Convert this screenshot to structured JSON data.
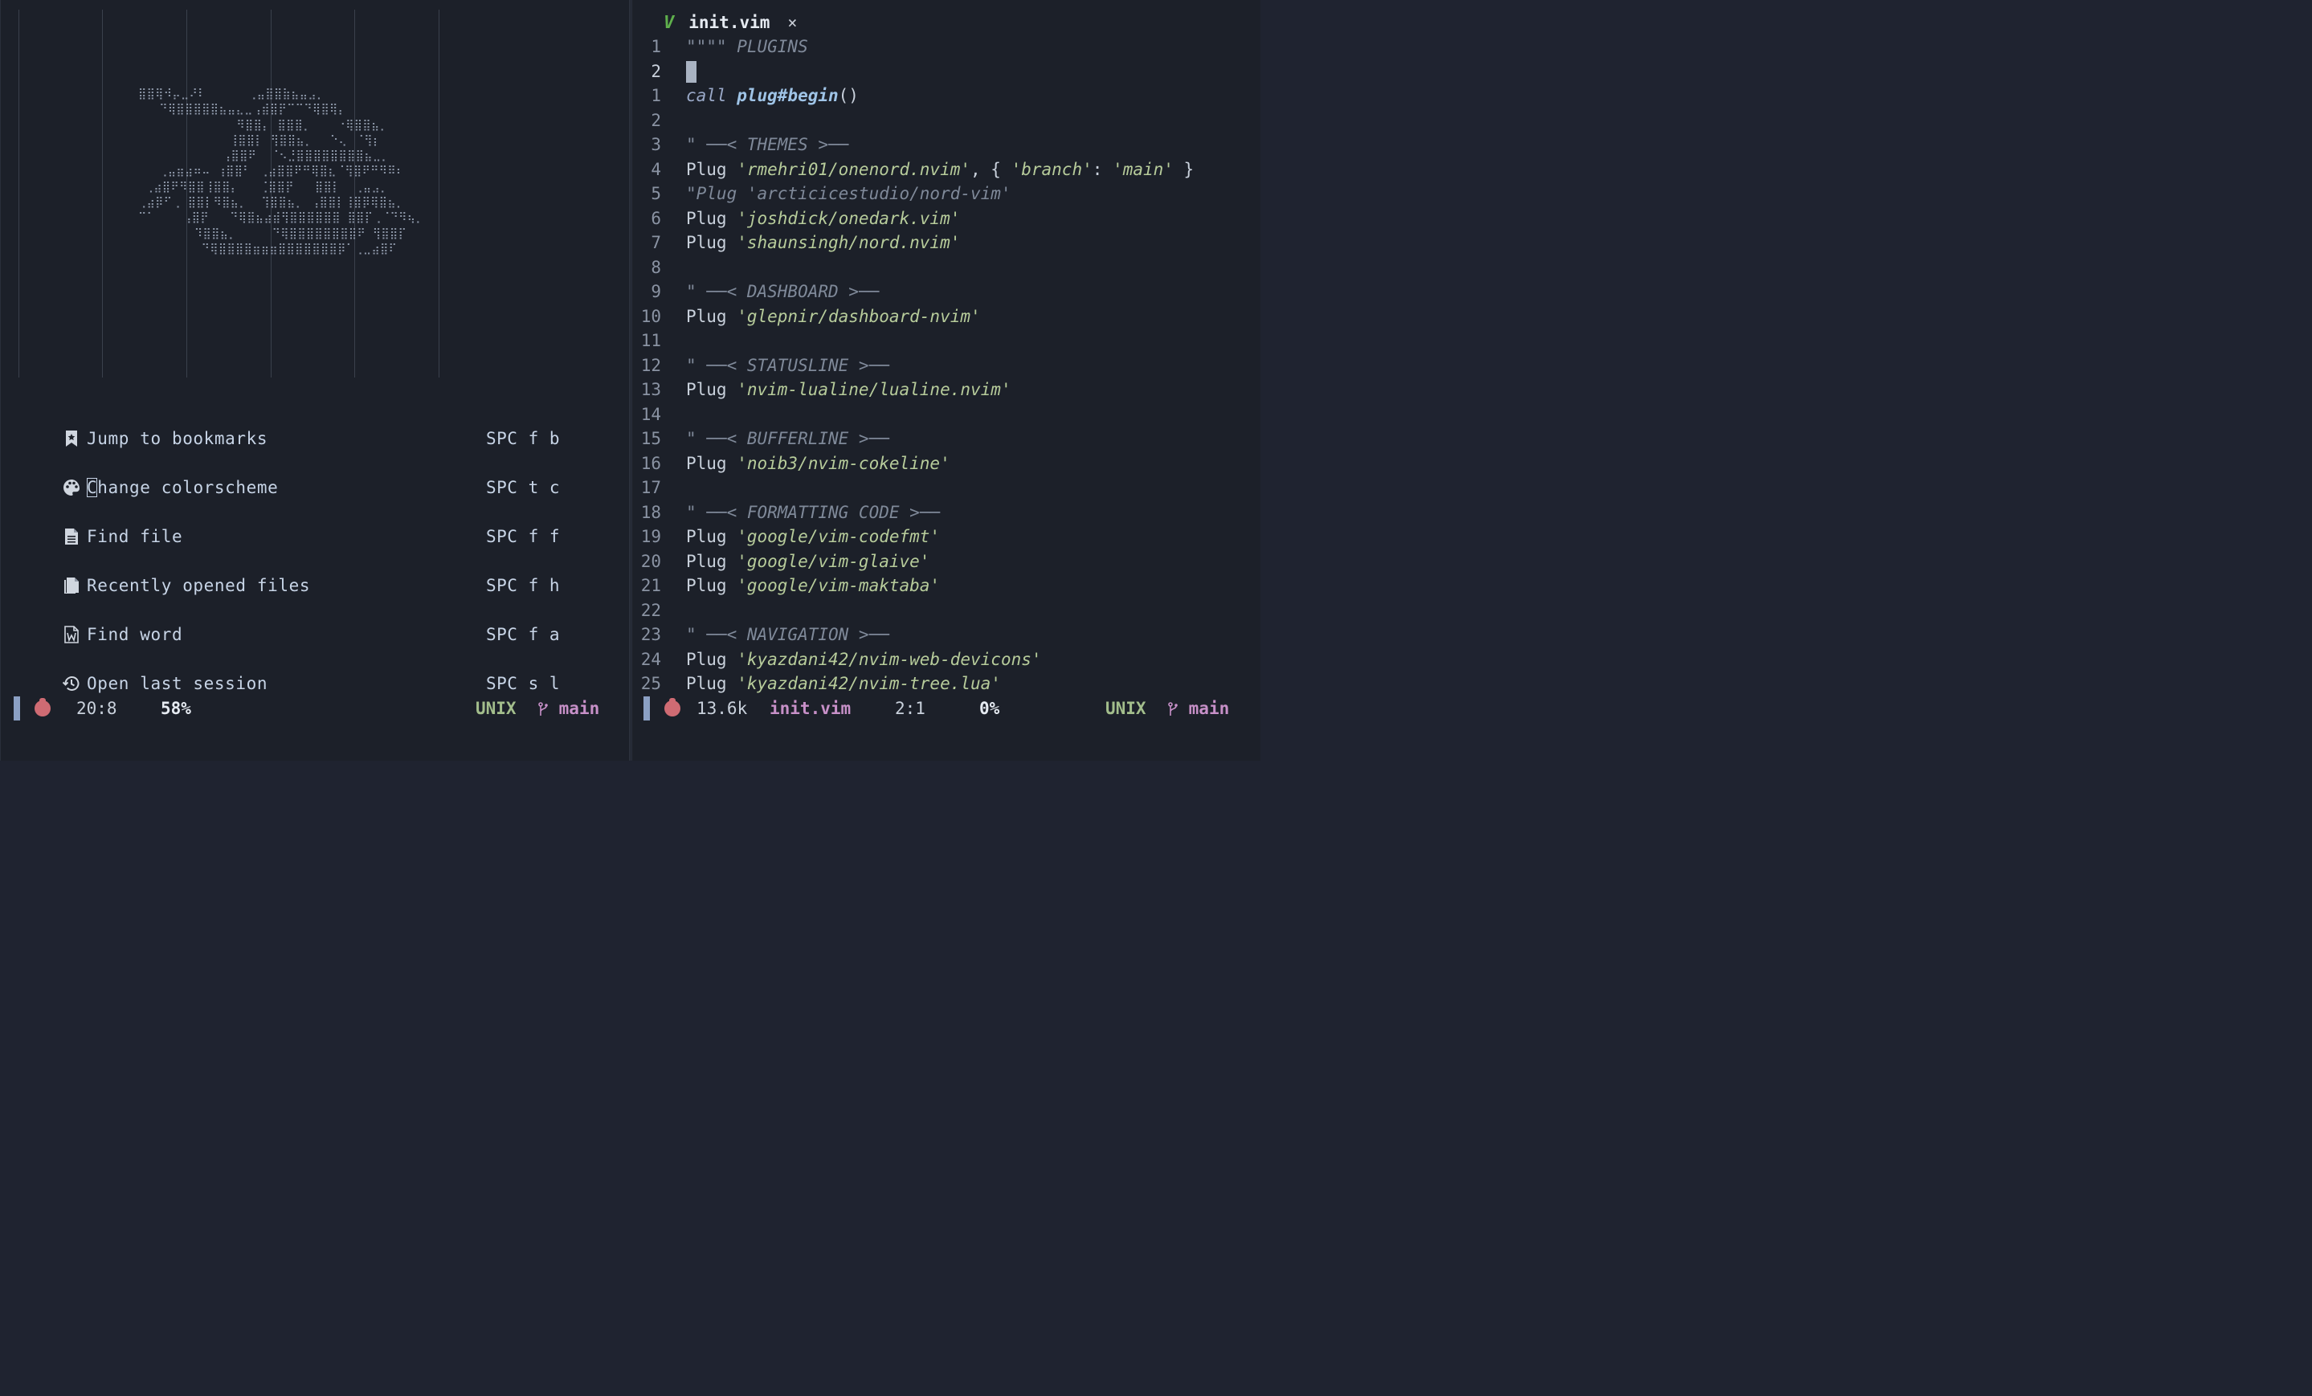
{
  "dashboard": {
    "logo_ascii": "⣿⣿⢿⠺⡤⣀⠜⠇      ⢀⣤⣿⣿⣷⣦⣤⣠⡀\n   ⠙⢿⣿⣿⣿⣿⣿⣦⣤⣄⣀⢠⣾⣿⡟⠉⠉⠙⢿⣿⢿⡄\n              ⠻⣿⣿⡄ ⣿⣿⣿⡀⠀⠀⠀⠐⢿⣿⣿⣦⡀\n             ⢸⣿⣿⡇ ⢻⣿⣿⣦⡀⠀⠀⠑⢄⠀⠈⢻⡆\n            ⢠⣿⣿⠟  ⠈⠢⣘⣿⣿⣿⣿⣿⣿⣿⣿⣦⣀⡀\n   ⢀⣤⣶⣴⠶⠤ ⢰⣿⣿⠃⠀⢀⣴⣿⣿⠟⠛⢿⣿⣆⠈⢻⣿⠟⠛⠻⠿⠆\n ⢀⣴⣿⠟⠻⣿⣿⢸⣿⣿⡄   ⢈⣿⣿⡟   ⣿⣿⡇  ⢀⣤⣠⡀\n⢀⣴⡿⠋⢀ ⣿⣿⡇⠻⣿⣦⡀  ⢹⣿⣿⣦⡀ ⢠⣿⣿⡇⢸⣿⡿⢿⣿⣦⡀\n⠉⠁    ⢠⣿⡟   ⠙⢿⣿⣦⣴⣾⢻⣿⣿⣿⣿⣿⣿ ⣿⣿⡏⢀⠈⠙⠻⢦⡀\n        ⠹⣿⣿⣦⡀     ⠙⢿⣿⣿⣿⣿⣿⣿⣿⣿⠟ ⢻⣿⣿⡏\n         ⠙⢿⣿⣿⣿⣿⣶⣶⣶⣿⣿⣿⣿⣿⣿⣿⡿⠁⢀⣀⣴⣿⠏",
    "items": [
      {
        "icon": "bookmark-icon",
        "label": "Jump to bookmarks",
        "key": "SPC f b"
      },
      {
        "icon": "palette-icon",
        "label_first": "C",
        "label_rest": "hange colorscheme",
        "key": "SPC t c"
      },
      {
        "icon": "file-icon",
        "label": "Find file",
        "key": "SPC f f"
      },
      {
        "icon": "files-icon",
        "label": "Recently opened files",
        "key": "SPC f h"
      },
      {
        "icon": "word-file-icon",
        "label": "Find word",
        "key": "SPC f a"
      },
      {
        "icon": "history-icon",
        "label": "Open last session",
        "key": "SPC s l"
      }
    ]
  },
  "left_status": {
    "position": "20:8",
    "percent": "58%",
    "format": "UNIX",
    "branch": "main"
  },
  "tab": {
    "icon": "vim-icon",
    "v_glyph": "V",
    "name": "init.vim",
    "close": "×"
  },
  "editor": {
    "lines": [
      {
        "n": "1",
        "parts": [
          [
            "c-comment",
            "\"\"\"\" PLUGINS"
          ]
        ]
      },
      {
        "n": "2",
        "cursor": true,
        "parts": []
      },
      {
        "n": "1",
        "parts": [
          [
            "c-kw",
            "call "
          ],
          [
            "c-fn",
            "plug#begin"
          ],
          [
            "c-punct",
            "()"
          ]
        ]
      },
      {
        "n": "2",
        "parts": []
      },
      {
        "n": "3",
        "parts": [
          [
            "c-comment",
            "\" ──< THEMES >──"
          ]
        ]
      },
      {
        "n": "4",
        "parts": [
          [
            "c-plain",
            "Plug "
          ],
          [
            "c-str",
            "'rmehri01/onenord.nvim'"
          ],
          [
            "c-punct",
            ", { "
          ],
          [
            "c-str",
            "'branch'"
          ],
          [
            "c-punct",
            ": "
          ],
          [
            "c-str",
            "'main'"
          ],
          [
            "c-punct",
            " }"
          ]
        ]
      },
      {
        "n": "5",
        "parts": [
          [
            "c-comment",
            "\"Plug 'arcticicestudio/nord-vim'"
          ]
        ]
      },
      {
        "n": "6",
        "parts": [
          [
            "c-plain",
            "Plug "
          ],
          [
            "c-str",
            "'joshdick/onedark.vim'"
          ]
        ]
      },
      {
        "n": "7",
        "parts": [
          [
            "c-plain",
            "Plug "
          ],
          [
            "c-str",
            "'shaunsingh/nord.nvim'"
          ]
        ]
      },
      {
        "n": "8",
        "parts": []
      },
      {
        "n": "9",
        "parts": [
          [
            "c-comment",
            "\" ──< DASHBOARD >──"
          ]
        ]
      },
      {
        "n": "10",
        "parts": [
          [
            "c-plain",
            "Plug "
          ],
          [
            "c-str",
            "'glepnir/dashboard-nvim'"
          ]
        ]
      },
      {
        "n": "11",
        "parts": []
      },
      {
        "n": "12",
        "parts": [
          [
            "c-comment",
            "\" ──< STATUSLINE >──"
          ]
        ]
      },
      {
        "n": "13",
        "parts": [
          [
            "c-plain",
            "Plug "
          ],
          [
            "c-str",
            "'nvim-lualine/lualine.nvim'"
          ]
        ]
      },
      {
        "n": "14",
        "parts": []
      },
      {
        "n": "15",
        "parts": [
          [
            "c-comment",
            "\" ──< BUFFERLINE >──"
          ]
        ]
      },
      {
        "n": "16",
        "parts": [
          [
            "c-plain",
            "Plug "
          ],
          [
            "c-str",
            "'noib3/nvim-cokeline'"
          ]
        ]
      },
      {
        "n": "17",
        "parts": []
      },
      {
        "n": "18",
        "parts": [
          [
            "c-comment",
            "\" ──< FORMATTING CODE >──"
          ]
        ]
      },
      {
        "n": "19",
        "parts": [
          [
            "c-plain",
            "Plug "
          ],
          [
            "c-str",
            "'google/vim-codefmt'"
          ]
        ]
      },
      {
        "n": "20",
        "parts": [
          [
            "c-plain",
            "Plug "
          ],
          [
            "c-str",
            "'google/vim-glaive'"
          ]
        ]
      },
      {
        "n": "21",
        "parts": [
          [
            "c-plain",
            "Plug "
          ],
          [
            "c-str",
            "'google/vim-maktaba'"
          ]
        ]
      },
      {
        "n": "22",
        "parts": []
      },
      {
        "n": "23",
        "parts": [
          [
            "c-comment",
            "\" ──< NAVIGATION >──"
          ]
        ]
      },
      {
        "n": "24",
        "parts": [
          [
            "c-plain",
            "Plug "
          ],
          [
            "c-str",
            "'kyazdani42/nvim-web-devicons'"
          ]
        ]
      },
      {
        "n": "25",
        "parts": [
          [
            "c-plain",
            "Plug "
          ],
          [
            "c-str",
            "'kyazdani42/nvim-tree.lua'"
          ]
        ]
      }
    ]
  },
  "right_status": {
    "size": "13.6k",
    "file": "init.vim",
    "position": "2:1",
    "percent": "0%",
    "format": "UNIX",
    "branch": "main"
  },
  "colors": {
    "background": "#1c2029",
    "string": "#b7cc9b",
    "comment": "#7f8999",
    "accent_green": "#a3be8c",
    "accent_pink": "#c790c8",
    "mode_block": "#8ba0c4",
    "error_icon": "#cf6b73"
  }
}
